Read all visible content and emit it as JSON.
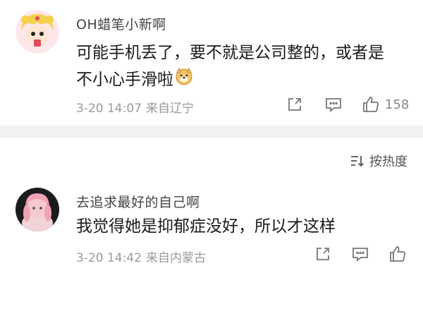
{
  "comments": [
    {
      "username": "OH蜡笔小新啊",
      "text_line1": "可能手机丢了，要不就是公司整的，或者是",
      "text_line2": "不小心手滑啦",
      "emoji": "doge-emoji",
      "date": "3-20 14:07",
      "location": "来自辽宁",
      "like_count": "158"
    },
    {
      "username": "去追求最好的自己啊",
      "text_line1": "我觉得她是抑郁症没好，所以才这样",
      "date": "3-20 14:42",
      "location": "来自内蒙古",
      "like_count": ""
    }
  ],
  "sort": {
    "label": "按热度",
    "icon": "sort-icon"
  },
  "icons": {
    "share": "share-icon",
    "comment": "comment-icon",
    "like": "thumbs-up-icon"
  },
  "colors": {
    "text": "#1a1a1a",
    "meta": "#9a9a9a",
    "divider": "#f2f2f2"
  }
}
